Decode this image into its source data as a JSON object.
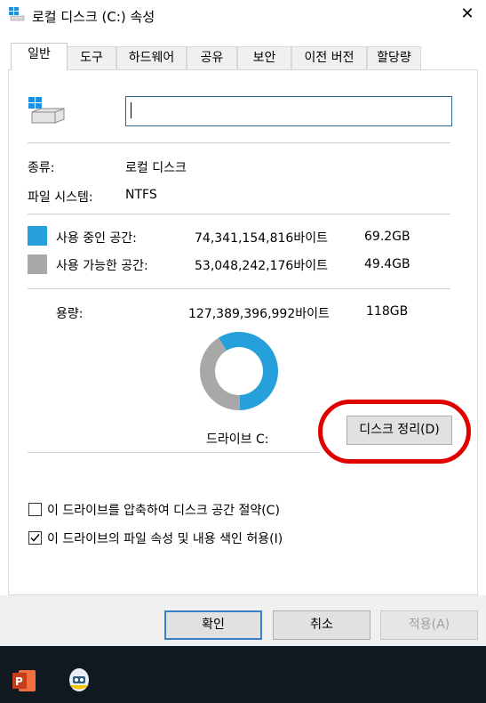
{
  "window": {
    "title": "로컬 디스크 (C:) 속성",
    "close_label": "✕"
  },
  "tabs": [
    {
      "label": "일반",
      "active": true
    },
    {
      "label": "도구"
    },
    {
      "label": "하드웨어"
    },
    {
      "label": "공유"
    },
    {
      "label": "보안"
    },
    {
      "label": "이전 버전"
    },
    {
      "label": "할당량"
    }
  ],
  "general": {
    "name_value": "",
    "type_label": "종류:",
    "type_value": "로컬 디스크",
    "fs_label": "파일 시스템:",
    "fs_value": "NTFS",
    "used": {
      "label": "사용 중인 공간:",
      "bytes": "74,341,154,816바이트",
      "size": "69.2GB",
      "color": "#26a0da"
    },
    "free": {
      "label": "사용 가능한 공간:",
      "bytes": "53,048,242,176바이트",
      "size": "49.4GB",
      "color": "#a8a8a8"
    },
    "capacity": {
      "label": "용량:",
      "bytes": "127,389,396,992바이트",
      "size": "118GB"
    },
    "used_fraction": 0.5836,
    "drive_label": "드라이브 C:",
    "cleanup_button": "디스크 정리(D)",
    "compress_checkbox": {
      "label": "이 드라이브를 압축하여 디스크 공간 절약(C)",
      "checked": false
    },
    "index_checkbox": {
      "label": "이 드라이브의 파일 속성 및 내용 색인 허용(I)",
      "checked": true
    }
  },
  "buttons": {
    "ok": "확인",
    "cancel": "취소",
    "apply": "적용(A)"
  },
  "taskbar": {
    "apps": [
      "powerpoint-icon",
      "penguin-app-icon"
    ]
  }
}
